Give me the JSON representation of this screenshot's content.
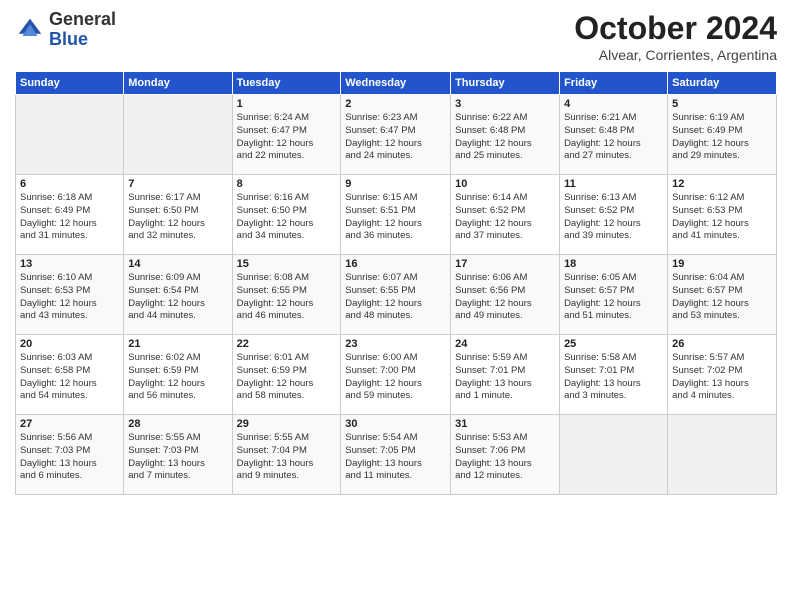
{
  "logo": {
    "general": "General",
    "blue": "Blue"
  },
  "header": {
    "month": "October 2024",
    "location": "Alvear, Corrientes, Argentina"
  },
  "days_of_week": [
    "Sunday",
    "Monday",
    "Tuesday",
    "Wednesday",
    "Thursday",
    "Friday",
    "Saturday"
  ],
  "weeks": [
    [
      {
        "day": "",
        "info": ""
      },
      {
        "day": "",
        "info": ""
      },
      {
        "day": "1",
        "info": "Sunrise: 6:24 AM\nSunset: 6:47 PM\nDaylight: 12 hours\nand 22 minutes."
      },
      {
        "day": "2",
        "info": "Sunrise: 6:23 AM\nSunset: 6:47 PM\nDaylight: 12 hours\nand 24 minutes."
      },
      {
        "day": "3",
        "info": "Sunrise: 6:22 AM\nSunset: 6:48 PM\nDaylight: 12 hours\nand 25 minutes."
      },
      {
        "day": "4",
        "info": "Sunrise: 6:21 AM\nSunset: 6:48 PM\nDaylight: 12 hours\nand 27 minutes."
      },
      {
        "day": "5",
        "info": "Sunrise: 6:19 AM\nSunset: 6:49 PM\nDaylight: 12 hours\nand 29 minutes."
      }
    ],
    [
      {
        "day": "6",
        "info": "Sunrise: 6:18 AM\nSunset: 6:49 PM\nDaylight: 12 hours\nand 31 minutes."
      },
      {
        "day": "7",
        "info": "Sunrise: 6:17 AM\nSunset: 6:50 PM\nDaylight: 12 hours\nand 32 minutes."
      },
      {
        "day": "8",
        "info": "Sunrise: 6:16 AM\nSunset: 6:50 PM\nDaylight: 12 hours\nand 34 minutes."
      },
      {
        "day": "9",
        "info": "Sunrise: 6:15 AM\nSunset: 6:51 PM\nDaylight: 12 hours\nand 36 minutes."
      },
      {
        "day": "10",
        "info": "Sunrise: 6:14 AM\nSunset: 6:52 PM\nDaylight: 12 hours\nand 37 minutes."
      },
      {
        "day": "11",
        "info": "Sunrise: 6:13 AM\nSunset: 6:52 PM\nDaylight: 12 hours\nand 39 minutes."
      },
      {
        "day": "12",
        "info": "Sunrise: 6:12 AM\nSunset: 6:53 PM\nDaylight: 12 hours\nand 41 minutes."
      }
    ],
    [
      {
        "day": "13",
        "info": "Sunrise: 6:10 AM\nSunset: 6:53 PM\nDaylight: 12 hours\nand 43 minutes."
      },
      {
        "day": "14",
        "info": "Sunrise: 6:09 AM\nSunset: 6:54 PM\nDaylight: 12 hours\nand 44 minutes."
      },
      {
        "day": "15",
        "info": "Sunrise: 6:08 AM\nSunset: 6:55 PM\nDaylight: 12 hours\nand 46 minutes."
      },
      {
        "day": "16",
        "info": "Sunrise: 6:07 AM\nSunset: 6:55 PM\nDaylight: 12 hours\nand 48 minutes."
      },
      {
        "day": "17",
        "info": "Sunrise: 6:06 AM\nSunset: 6:56 PM\nDaylight: 12 hours\nand 49 minutes."
      },
      {
        "day": "18",
        "info": "Sunrise: 6:05 AM\nSunset: 6:57 PM\nDaylight: 12 hours\nand 51 minutes."
      },
      {
        "day": "19",
        "info": "Sunrise: 6:04 AM\nSunset: 6:57 PM\nDaylight: 12 hours\nand 53 minutes."
      }
    ],
    [
      {
        "day": "20",
        "info": "Sunrise: 6:03 AM\nSunset: 6:58 PM\nDaylight: 12 hours\nand 54 minutes."
      },
      {
        "day": "21",
        "info": "Sunrise: 6:02 AM\nSunset: 6:59 PM\nDaylight: 12 hours\nand 56 minutes."
      },
      {
        "day": "22",
        "info": "Sunrise: 6:01 AM\nSunset: 6:59 PM\nDaylight: 12 hours\nand 58 minutes."
      },
      {
        "day": "23",
        "info": "Sunrise: 6:00 AM\nSunset: 7:00 PM\nDaylight: 12 hours\nand 59 minutes."
      },
      {
        "day": "24",
        "info": "Sunrise: 5:59 AM\nSunset: 7:01 PM\nDaylight: 13 hours\nand 1 minute."
      },
      {
        "day": "25",
        "info": "Sunrise: 5:58 AM\nSunset: 7:01 PM\nDaylight: 13 hours\nand 3 minutes."
      },
      {
        "day": "26",
        "info": "Sunrise: 5:57 AM\nSunset: 7:02 PM\nDaylight: 13 hours\nand 4 minutes."
      }
    ],
    [
      {
        "day": "27",
        "info": "Sunrise: 5:56 AM\nSunset: 7:03 PM\nDaylight: 13 hours\nand 6 minutes."
      },
      {
        "day": "28",
        "info": "Sunrise: 5:55 AM\nSunset: 7:03 PM\nDaylight: 13 hours\nand 7 minutes."
      },
      {
        "day": "29",
        "info": "Sunrise: 5:55 AM\nSunset: 7:04 PM\nDaylight: 13 hours\nand 9 minutes."
      },
      {
        "day": "30",
        "info": "Sunrise: 5:54 AM\nSunset: 7:05 PM\nDaylight: 13 hours\nand 11 minutes."
      },
      {
        "day": "31",
        "info": "Sunrise: 5:53 AM\nSunset: 7:06 PM\nDaylight: 13 hours\nand 12 minutes."
      },
      {
        "day": "",
        "info": ""
      },
      {
        "day": "",
        "info": ""
      }
    ]
  ]
}
